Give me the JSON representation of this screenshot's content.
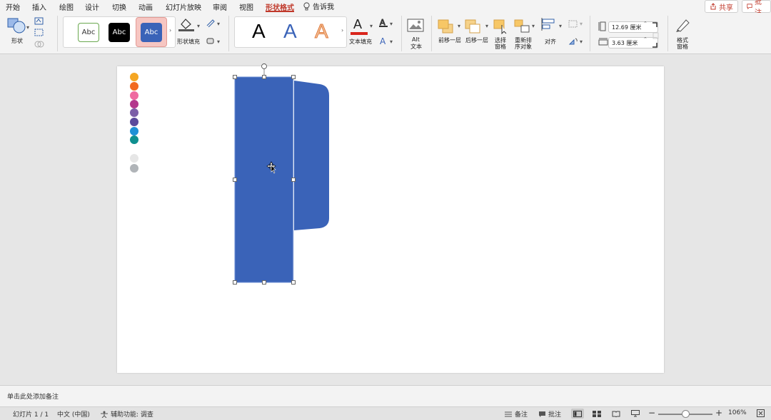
{
  "menu": {
    "tabs": [
      {
        "label": "开始"
      },
      {
        "label": "插入"
      },
      {
        "label": "绘图"
      },
      {
        "label": "设计"
      },
      {
        "label": "切换"
      },
      {
        "label": "动画"
      },
      {
        "label": "幻灯片放映"
      },
      {
        "label": "审阅"
      },
      {
        "label": "视图"
      },
      {
        "label": "形状格式",
        "active": true
      }
    ],
    "tell_me": "告诉我",
    "share": "共享",
    "comments": "批注"
  },
  "ribbon": {
    "shapes_label": "形状",
    "style_samples": [
      "Abc",
      "Abc",
      "Abc"
    ],
    "shape_fill_label": "形状填充",
    "wordart_samples": [
      "A",
      "A",
      "A"
    ],
    "text_fill_label": "文本填充",
    "alt_text_label_1": "Alt",
    "alt_text_label_2": "文本",
    "bring_forward": "前移一层",
    "send_backward": "后移一层",
    "selection_pane_1": "选择",
    "selection_pane_2": "窗格",
    "reorder_1": "重新排",
    "reorder_2": "序对象",
    "align": "对齐",
    "height_value": "12.69 厘米",
    "width_value": "3.63 厘米",
    "format_pane_1": "格式",
    "format_pane_2": "窗格"
  },
  "colors": {
    "accent": "#c0392b",
    "shape_fill": "#3a63b8",
    "palette": [
      "#f5a623",
      "#f26a21",
      "#ef6aa0",
      "#b3388d",
      "#7b5ea7",
      "#5b4a9c",
      "#1e90d6",
      "#0f8f8f",
      "#e6e6e6",
      "#b0b4b8"
    ]
  },
  "notes": {
    "placeholder": "单击此处添加备注"
  },
  "status": {
    "slide": "幻灯片 1 / 1",
    "language": "中文 (中国)",
    "accessibility": "辅助功能: 调查",
    "notes_btn": "备注",
    "comments_btn": "批注",
    "zoom": "106%",
    "zoom_level": 0.5
  }
}
